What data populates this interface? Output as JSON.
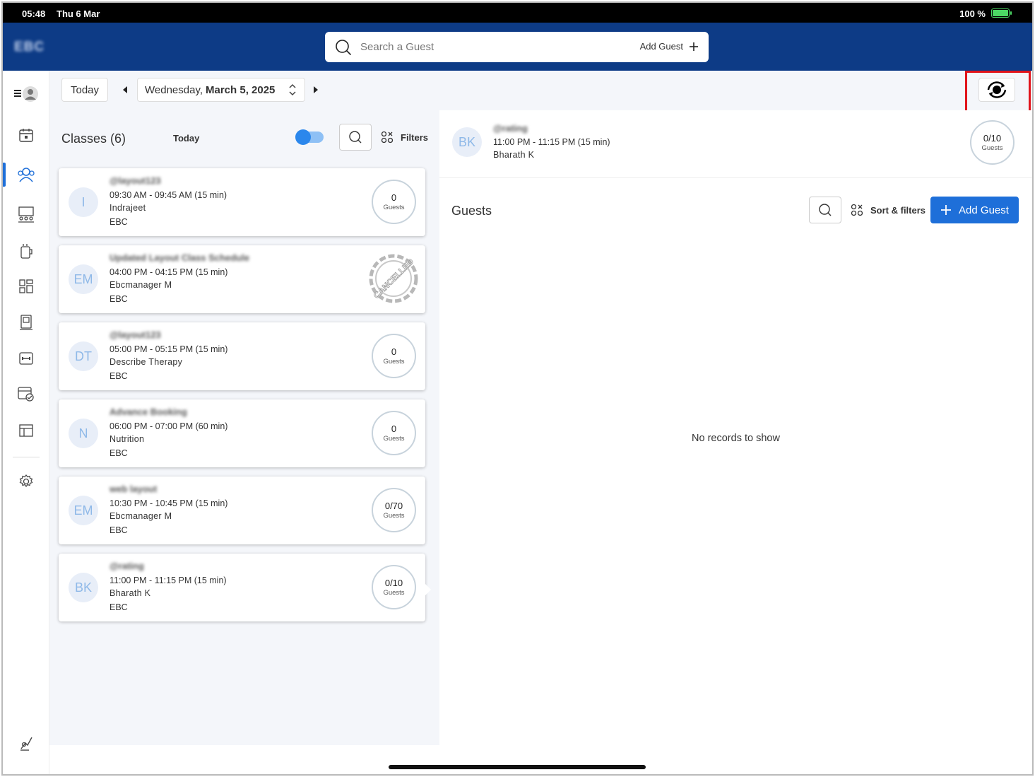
{
  "status_bar": {
    "time": "05:48",
    "date": "Thu 6 Mar",
    "battery": "100 %"
  },
  "header": {
    "logo": "EBC",
    "search_placeholder": "Search a Guest",
    "add_guest_label": "Add Guest"
  },
  "toolbar": {
    "today_label": "Today",
    "date_prefix": "Wednesday,",
    "date_strong": "March 5, 2025"
  },
  "classes": {
    "title": "Classes (6)",
    "today_label": "Today",
    "filters_label": "Filters",
    "items": [
      {
        "initials": "I",
        "name": "@layout123",
        "time": "09:30 AM - 09:45 AM (15 min)",
        "instructor": "Indrajeet",
        "location": "EBC",
        "count": "0",
        "count_label": "Guests"
      },
      {
        "initials": "EM",
        "name": "Updated Layout Class Schedule",
        "time": "04:00 PM - 04:15 PM (15 min)",
        "instructor": "Ebcmanager M",
        "location": "EBC",
        "stamp": "CANCELLED"
      },
      {
        "initials": "DT",
        "name": "@layout123",
        "time": "05:00 PM - 05:15 PM (15 min)",
        "instructor": "Describe Therapy",
        "location": "EBC",
        "count": "0",
        "count_label": "Guests"
      },
      {
        "initials": "N",
        "name": "Advance Booking",
        "time": "06:00 PM - 07:00 PM (60 min)",
        "instructor": "Nutrition",
        "location": "EBC",
        "count": "0",
        "count_label": "Guests"
      },
      {
        "initials": "EM",
        "name": "web layout",
        "time": "10:30 PM - 10:45 PM (15 min)",
        "instructor": "Ebcmanager M",
        "location": "EBC",
        "count": "0/70",
        "count_label": "Guests"
      },
      {
        "initials": "BK",
        "name": "@rating",
        "time": "11:00 PM - 11:15 PM (15 min)",
        "instructor": "Bharath K",
        "location": "EBC",
        "count": "0/10",
        "count_label": "Guests"
      }
    ]
  },
  "detail": {
    "initials": "BK",
    "name": "@rating",
    "time": "11:00 PM - 11:15 PM (15 min)",
    "instructor": "Bharath K",
    "count": "0/10",
    "count_label": "Guests",
    "guests_title": "Guests",
    "sort_filters_label": "Sort & filters",
    "add_guest_label": "Add Guest",
    "empty_message": "No records to show"
  },
  "colors": {
    "header_bg": "#0d3b86",
    "accent": "#1e6fd9",
    "highlight": "#e1141b"
  }
}
